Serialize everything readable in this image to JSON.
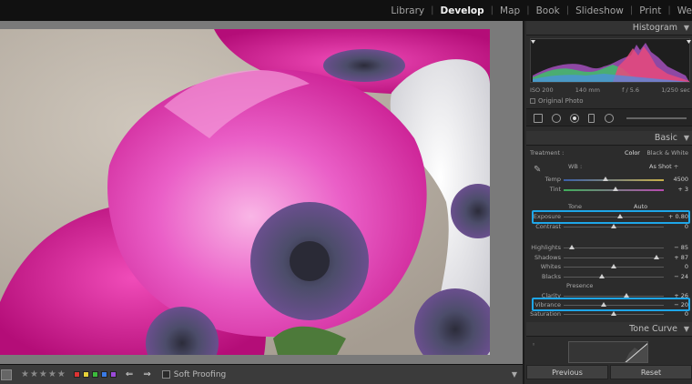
{
  "modules": [
    "Library",
    "Develop",
    "Map",
    "Book",
    "Slideshow",
    "Print",
    "We"
  ],
  "active_module": "Develop",
  "panels": {
    "histogram": {
      "title": "Histogram",
      "iso": "ISO 200",
      "focal": "140 mm",
      "aperture": "f / 5.6",
      "shutter": "1/250 sec",
      "original_photo": "Original Photo"
    },
    "basic": {
      "title": "Basic",
      "treatment_label": "Treatment :",
      "treatment_color": "Color",
      "treatment_bw": "Black & White",
      "wb_label": "WB :",
      "wb_value": "As Shot ÷",
      "tone_label": "Tone",
      "tone_auto": "Auto",
      "presence_label": "Presence",
      "sliders": [
        {
          "label": "Temp",
          "value": "4500",
          "pos": 0.42
        },
        {
          "label": "Tint",
          "value": "+ 3",
          "pos": 0.52
        },
        {
          "label": "Exposure",
          "value": "+ 0.80",
          "pos": 0.56
        },
        {
          "label": "Contrast",
          "value": "0",
          "pos": 0.5
        },
        {
          "label": "Highlights",
          "value": "− 85",
          "pos": 0.08
        },
        {
          "label": "Shadows",
          "value": "+ 87",
          "pos": 0.93
        },
        {
          "label": "Whites",
          "value": "0",
          "pos": 0.5
        },
        {
          "label": "Blacks",
          "value": "− 24",
          "pos": 0.38
        },
        {
          "label": "Clarity",
          "value": "+ 26",
          "pos": 0.63
        },
        {
          "label": "Vibrance",
          "value": "− 20",
          "pos": 0.4
        },
        {
          "label": "Saturation",
          "value": "0",
          "pos": 0.5
        }
      ]
    },
    "tone_curve": {
      "title": "Tone Curve"
    }
  },
  "buttons": {
    "previous": "Previous",
    "reset": "Reset"
  },
  "toolbar": {
    "stars": "★★★★★",
    "soft_proofing": "Soft Proofing",
    "arrows": "⇐ ⇒",
    "flag_colors": [
      "#d33",
      "#e6d23a",
      "#3cba3c",
      "#3a7be6",
      "#9b4ad8"
    ]
  },
  "colors": {
    "highlight": "#1ea6e8"
  }
}
